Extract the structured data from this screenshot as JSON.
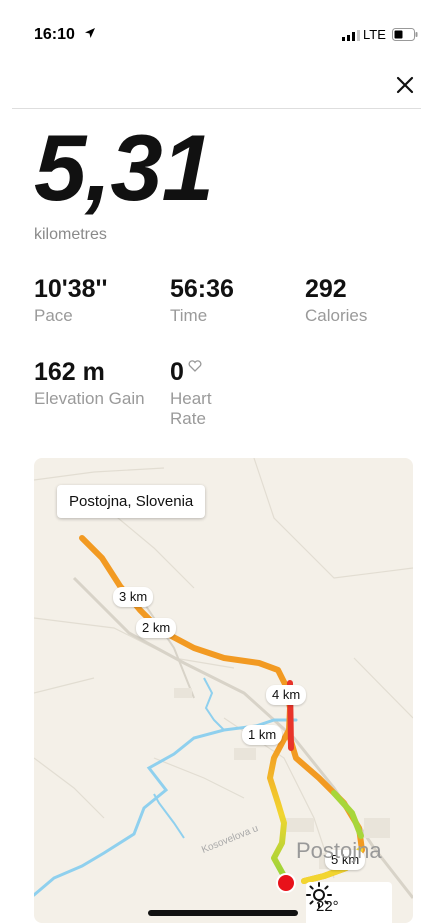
{
  "status": {
    "time": "16:10",
    "network": "LTE",
    "icons": [
      "location-arrow-icon",
      "signal-icon",
      "battery-icon"
    ]
  },
  "header": {
    "close_icon": "close-icon"
  },
  "run": {
    "distance": "5,31",
    "distance_unit": "kilometres",
    "stats": [
      {
        "value": "10'38''",
        "label": "Pace"
      },
      {
        "value": "56:36",
        "label": "Time"
      },
      {
        "value": "292",
        "label": "Calories"
      },
      {
        "value": "162 m",
        "label": "Elevation Gain"
      },
      {
        "value": "0",
        "label": "Heart Rate"
      }
    ]
  },
  "map": {
    "location": "Postojna, Slovenia",
    "markers": [
      "3 km",
      "2 km",
      "4 km",
      "1 km",
      "5 km"
    ],
    "street": "Kosovelova u",
    "town": "Postojna",
    "weather": {
      "temperature": "22°",
      "icon": "sun-icon"
    },
    "colors": {
      "route_red": "#e8342a",
      "route_orange": "#f29a22",
      "route_yellow": "#f2d530",
      "route_green": "#8fd43a",
      "end_marker": "#e8121a",
      "river": "#8fd0ee"
    }
  }
}
